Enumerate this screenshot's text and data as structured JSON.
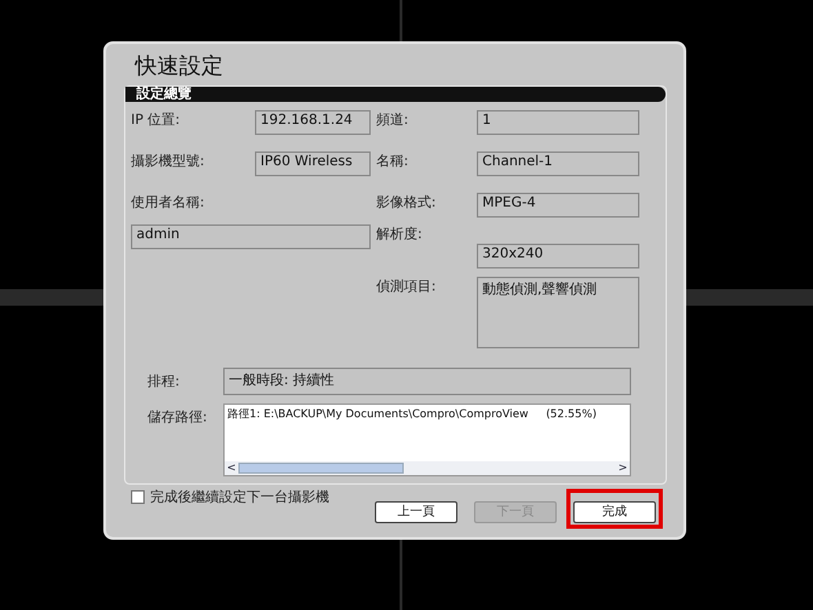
{
  "window": {
    "title": "快速設定"
  },
  "section": {
    "title": "設定總覽"
  },
  "ip": {
    "label": "IP 位置:",
    "value": "192.168.1.24"
  },
  "model": {
    "label": "攝影機型號:",
    "value": "IP60 Wireless"
  },
  "username": {
    "label": "使用者名稱:",
    "value": "admin"
  },
  "channel": {
    "label": "頻道:",
    "value": "1"
  },
  "name": {
    "label": "名稱:",
    "value": "Channel-1"
  },
  "format": {
    "label": "影像格式:",
    "value": "MPEG-4"
  },
  "resolution": {
    "label": "解析度:",
    "value": "320x240"
  },
  "detection": {
    "label": "偵測項目:",
    "value": "動態偵測,聲響偵測"
  },
  "schedule": {
    "label": "排程:",
    "value": "一般時段: 持續性"
  },
  "storage": {
    "label": "儲存路徑:",
    "value": "路徑1: E:\\BACKUP\\My Documents\\Compro\\ComproView     (52.55%)",
    "scroll_left": "<",
    "scroll_right": ">"
  },
  "continue_option": {
    "label": "完成後繼續設定下一台攝影機",
    "checked": false
  },
  "buttons": [
    {
      "label": "上一頁",
      "disabled": false,
      "highlighted": false
    },
    {
      "label": "下一頁",
      "disabled": true,
      "highlighted": false
    },
    {
      "label": "完成",
      "disabled": false,
      "highlighted": true
    }
  ]
}
